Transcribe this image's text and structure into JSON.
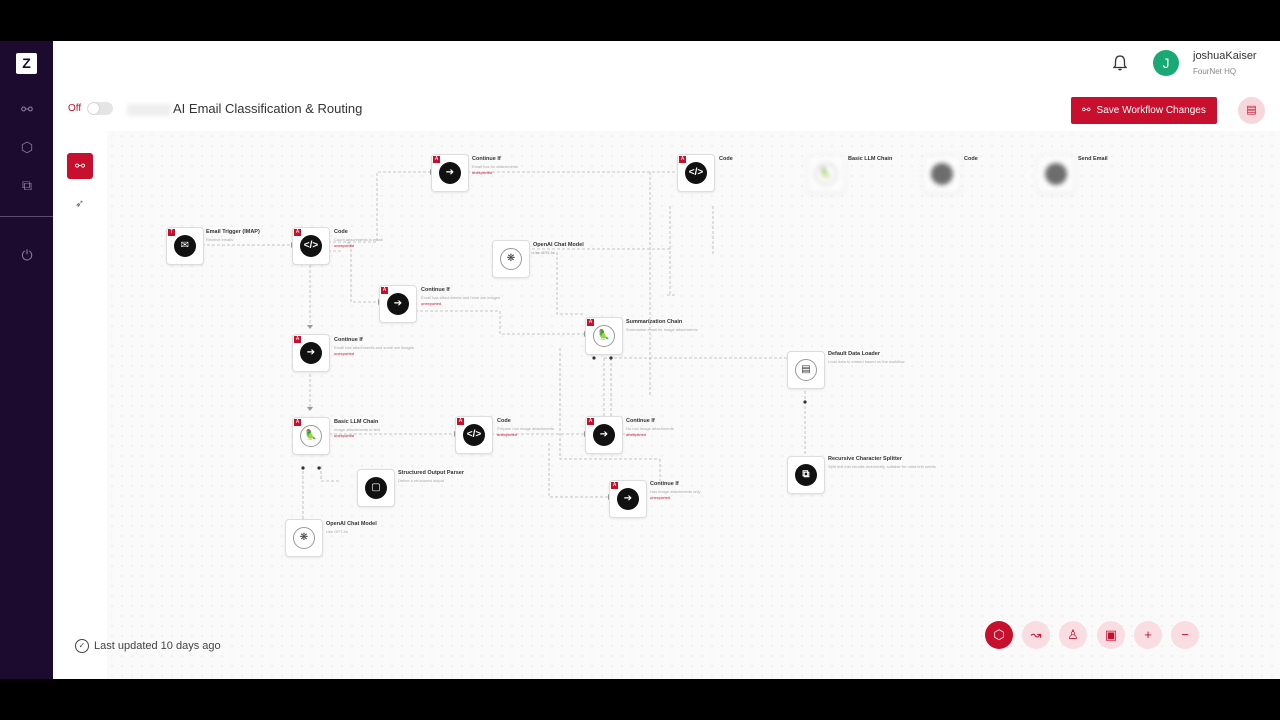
{
  "header": {
    "user_name": "joshuaKaiser",
    "user_org": "FourNet HQ",
    "avatar_initial": "J"
  },
  "toolbar": {
    "status": "Off",
    "workflow_title": "AI Email Classification & Routing",
    "save_label": "Save Workflow Changes"
  },
  "nodes": [
    {
      "label": "Email Trigger (IMAP)",
      "sub": "Receive emails",
      "status": "",
      "icon": "mail-icon"
    },
    {
      "label": "Code",
      "sub": "Count attachments in email",
      "status": "unexported",
      "icon": "code-icon"
    },
    {
      "label": "Continue If",
      "sub": "Email has no attachments",
      "status": "unexported",
      "icon": "branch-icon"
    },
    {
      "label": "Code",
      "sub": "",
      "status": "",
      "icon": "code-icon"
    },
    {
      "label": "Basic LLM Chain",
      "sub": "",
      "status": "",
      "icon": "parrot-icon"
    },
    {
      "label": "Code",
      "sub": "",
      "status": "",
      "icon": "code-icon"
    },
    {
      "label": "Send Email",
      "sub": "",
      "status": "",
      "icon": "send-icon"
    },
    {
      "label": "OpenAI Chat Model",
      "sub": "Use GPT-4o",
      "status": "",
      "icon": "openai-icon"
    },
    {
      "label": "Continue If",
      "sub": "Email has attachments and none are images",
      "status": "unexported",
      "icon": "branch-icon"
    },
    {
      "label": "Summarization Chain",
      "sub": "Summarise email for image attachments",
      "status": "unexported",
      "icon": "parrot-icon"
    },
    {
      "label": "Continue If",
      "sub": "Email has attachments and some are images",
      "status": "unexported",
      "icon": "branch-icon"
    },
    {
      "label": "Default Data Loader",
      "sub": "Load data to embed based on the workflow",
      "status": "",
      "icon": "document-icon"
    },
    {
      "label": "Basic LLM Chain",
      "sub": "Image attachments to text",
      "status": "unexported",
      "icon": "parrot-icon"
    },
    {
      "label": "Code",
      "sub": "Prepare non image attachments",
      "status": "unexported",
      "icon": "code-icon"
    },
    {
      "label": "Continue If",
      "sub": "No non image attachments",
      "status": "unexported",
      "icon": "branch-icon"
    },
    {
      "label": "Recursive Character Splitter",
      "sub": "Split text into chunks recursively, suitable for most text needs",
      "status": "",
      "icon": "splitter-icon"
    },
    {
      "label": "Structured Output Parser",
      "sub": "Define a structured output",
      "status": "",
      "icon": "parser-icon"
    },
    {
      "label": "Continue If",
      "sub": "Has image attachments only",
      "status": "unexported",
      "icon": "branch-icon"
    },
    {
      "label": "OpenAI Chat Model",
      "sub": "Use GPT-4o",
      "status": "",
      "icon": "openai-icon"
    }
  ],
  "footer": {
    "last_updated": "Last updated 10 days ago"
  },
  "colors": {
    "brand": "#c8102e",
    "sidebar": "#1c0b2e"
  }
}
